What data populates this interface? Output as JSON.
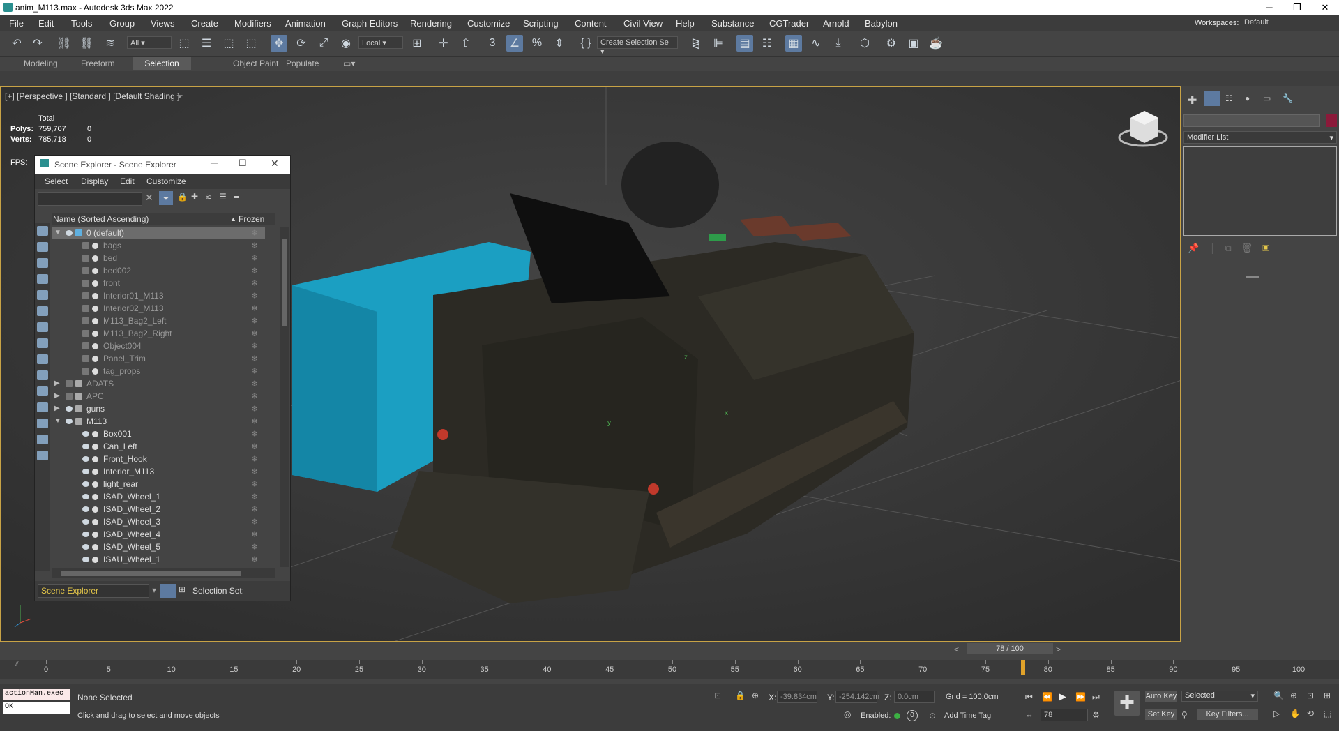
{
  "window": {
    "title": "anim_M113.max - Autodesk 3ds Max 2022"
  },
  "menubar": {
    "items": [
      "File",
      "Edit",
      "Tools",
      "Group",
      "Views",
      "Create",
      "Modifiers",
      "Animation",
      "Graph Editors",
      "Rendering",
      "Customize",
      "Scripting",
      "Content",
      "Civil View",
      "Help",
      "Substance",
      "CGTrader",
      "Arnold",
      "Babylon"
    ],
    "workspaces_label": "Workspaces:",
    "workspace_value": "Default"
  },
  "toolbar": {
    "filter_value": "All",
    "coord_value": "Local",
    "selection_set_value": "Create Selection Se"
  },
  "ribbon": {
    "tabs": [
      "Modeling",
      "Freeform",
      "Selection",
      "Object Paint",
      "Populate"
    ],
    "selected": "Selection"
  },
  "viewport": {
    "label": "[+] [Perspective ] [Standard ] [Default Shading ]",
    "stats": {
      "total_label": "Total",
      "polys_label": "Polys:",
      "polys_total": "759,707",
      "polys_sel": "0",
      "verts_label": "Verts:",
      "verts_total": "785,718",
      "verts_sel": "0",
      "fps_label": "FPS:"
    },
    "axis_labels": {
      "x": "x",
      "y": "y",
      "z": "z"
    }
  },
  "explorer": {
    "title": "Scene Explorer - Scene Explorer",
    "menu": [
      "Select",
      "Display",
      "Edit",
      "Customize"
    ],
    "col_name": "Name (Sorted Ascending)",
    "col_frozen": "Frozen",
    "rows": [
      {
        "name": "0 (default)",
        "type": "layer",
        "indent": 0,
        "expanded": true,
        "sel": true
      },
      {
        "name": "bags",
        "type": "obj",
        "indent": 1,
        "hidden": true
      },
      {
        "name": "bed",
        "type": "obj",
        "indent": 1,
        "hidden": true
      },
      {
        "name": "bed002",
        "type": "obj",
        "indent": 1,
        "hidden": true
      },
      {
        "name": "front",
        "type": "obj",
        "indent": 1,
        "hidden": true
      },
      {
        "name": "Interior01_M113",
        "type": "obj",
        "indent": 1,
        "hidden": true
      },
      {
        "name": "Interior02_M113",
        "type": "obj",
        "indent": 1,
        "hidden": true
      },
      {
        "name": "M113_Bag2_Left",
        "type": "obj",
        "indent": 1,
        "hidden": true
      },
      {
        "name": "M113_Bag2_Right",
        "type": "obj",
        "indent": 1,
        "hidden": true
      },
      {
        "name": "Object004",
        "type": "obj",
        "indent": 1,
        "hidden": true
      },
      {
        "name": "Panel_Trim",
        "type": "obj",
        "indent": 1,
        "hidden": true
      },
      {
        "name": "tag_props",
        "type": "obj",
        "indent": 1,
        "hidden": true
      },
      {
        "name": "ADATS",
        "type": "layer",
        "indent": 0,
        "hidden": true,
        "expanded": false
      },
      {
        "name": "APC",
        "type": "layer",
        "indent": 0,
        "hidden": true,
        "expanded": false
      },
      {
        "name": "guns",
        "type": "layer",
        "indent": 0,
        "expanded": false
      },
      {
        "name": "M113",
        "type": "layer",
        "indent": 0,
        "expanded": true
      },
      {
        "name": "Box001",
        "type": "obj",
        "indent": 1
      },
      {
        "name": "Can_Left",
        "type": "obj",
        "indent": 1
      },
      {
        "name": "Front_Hook",
        "type": "obj",
        "indent": 1
      },
      {
        "name": "Interior_M113",
        "type": "obj",
        "indent": 1
      },
      {
        "name": "light_rear",
        "type": "obj",
        "indent": 1
      },
      {
        "name": "ISAD_Wheel_1",
        "type": "obj",
        "indent": 1
      },
      {
        "name": "ISAD_Wheel_2",
        "type": "obj",
        "indent": 1
      },
      {
        "name": "ISAD_Wheel_3",
        "type": "obj",
        "indent": 1
      },
      {
        "name": "ISAD_Wheel_4",
        "type": "obj",
        "indent": 1
      },
      {
        "name": "ISAD_Wheel_5",
        "type": "obj",
        "indent": 1
      },
      {
        "name": "ISAU_Wheel_1",
        "type": "obj",
        "indent": 1
      }
    ],
    "footer_dropdown": "Scene Explorer",
    "selection_set_label": "Selection Set:"
  },
  "command_panel": {
    "modifier_list": "Modifier List",
    "accent_color": "#8b1a3a"
  },
  "timeline": {
    "frame_label": "78 / 100",
    "current_frame": 78,
    "total_frames": 100,
    "ticks": [
      0,
      5,
      10,
      15,
      20,
      25,
      30,
      35,
      40,
      45,
      50,
      55,
      60,
      65,
      70,
      75,
      80,
      85,
      90,
      95,
      100
    ]
  },
  "status": {
    "script_box": "actionMan.exec",
    "script_out": "OK",
    "selection_text": "None Selected",
    "prompt_text": "Click and drag to select and move objects",
    "x_label": "X:",
    "x_value": "-39.834cm",
    "y_label": "Y:",
    "y_value": "-254.142cm",
    "z_label": "Z:",
    "z_value": "0.0cm",
    "grid_text": "Grid = 100.0cm",
    "enabled_label": "Enabled:",
    "add_time_tag": "Add Time Tag",
    "auto_key": "Auto Key",
    "selected_dropdown": "Selected",
    "set_key": "Set Key",
    "key_filters": "Key Filters...",
    "frame_field": "78"
  }
}
